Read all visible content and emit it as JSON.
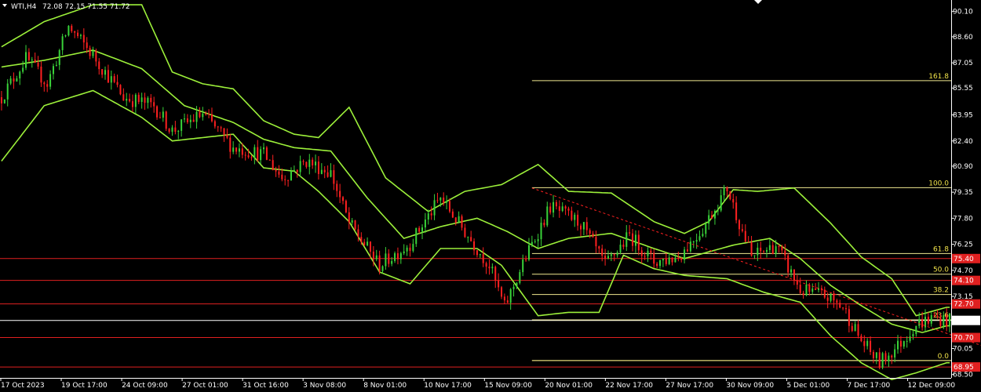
{
  "header": {
    "symbol": "WTI,H4",
    "ohlc": "72.08 72.15 71.55 71.72"
  },
  "colors": {
    "background": "#000000",
    "bull": "#39d339",
    "bear": "#ff2020",
    "bands": "#9cf03a",
    "fib": "#f0e890",
    "hline_red": "#e02020",
    "hline_yellow": "#f0d020",
    "price_tag_white": "#ffffff",
    "price_tag_red": "#e02020"
  },
  "chart_data": {
    "type": "candlestick",
    "symbol": "WTI",
    "timeframe": "H4",
    "ylim": [
      68.3,
      90.6
    ],
    "y_ticks": [
      "90.10",
      "88.60",
      "87.05",
      "85.55",
      "83.95",
      "82.40",
      "80.90",
      "79.35",
      "77.80",
      "76.25",
      "74.70",
      "73.15",
      "70.05",
      "68.50"
    ],
    "x_ticks": [
      "17 Oct 2023",
      "19 Oct 17:00",
      "24 Oct 09:00",
      "27 Oct 01:00",
      "31 Oct 16:00",
      "3 Nov 08:00",
      "8 Nov 01:00",
      "10 Nov 17:00",
      "15 Nov 09:00",
      "20 Nov 01:00",
      "22 Nov 17:00",
      "27 Nov 17:00",
      "30 Nov 09:00",
      "5 Dec 01:00",
      "7 Dec 17:00",
      "12 Dec 09:00"
    ],
    "close_path": [
      {
        "t": 0,
        "p": 85.0
      },
      {
        "t": 8,
        "p": 87.3
      },
      {
        "t": 15,
        "p": 85.8
      },
      {
        "t": 22,
        "p": 89.2
      },
      {
        "t": 30,
        "p": 87.5
      },
      {
        "t": 40,
        "p": 85.0
      },
      {
        "t": 50,
        "p": 84.5
      },
      {
        "t": 56,
        "p": 83.0
      },
      {
        "t": 66,
        "p": 84.0
      },
      {
        "t": 76,
        "p": 82.0
      },
      {
        "t": 86,
        "p": 81.6
      },
      {
        "t": 92,
        "p": 80.2
      },
      {
        "t": 100,
        "p": 81.2
      },
      {
        "t": 108,
        "p": 80.5
      },
      {
        "t": 114,
        "p": 77.5
      },
      {
        "t": 124,
        "p": 75.0
      },
      {
        "t": 134,
        "p": 76.3
      },
      {
        "t": 144,
        "p": 79.0
      },
      {
        "t": 152,
        "p": 77.0
      },
      {
        "t": 160,
        "p": 75.0
      },
      {
        "t": 165,
        "p": 72.5
      },
      {
        "t": 172,
        "p": 75.5
      },
      {
        "t": 180,
        "p": 78.5
      },
      {
        "t": 190,
        "p": 77.5
      },
      {
        "t": 198,
        "p": 75.0
      },
      {
        "t": 206,
        "p": 76.8
      },
      {
        "t": 214,
        "p": 75.2
      },
      {
        "t": 222,
        "p": 75.5
      },
      {
        "t": 230,
        "p": 77.2
      },
      {
        "t": 238,
        "p": 79.6
      },
      {
        "t": 246,
        "p": 75.5
      },
      {
        "t": 254,
        "p": 76.2
      },
      {
        "t": 262,
        "p": 73.5
      },
      {
        "t": 270,
        "p": 73.2
      },
      {
        "t": 276,
        "p": 72.5
      },
      {
        "t": 282,
        "p": 70.5
      },
      {
        "t": 288,
        "p": 69.2
      },
      {
        "t": 294,
        "p": 70.2
      },
      {
        "t": 300,
        "p": 71.5
      },
      {
        "t": 306,
        "p": 71.9
      },
      {
        "t": 310,
        "p": 71.72
      }
    ],
    "total_bars": 312,
    "upper_band": [
      {
        "t": 0,
        "p": 88.0
      },
      {
        "t": 14,
        "p": 89.5
      },
      {
        "t": 30,
        "p": 90.5
      },
      {
        "t": 46,
        "p": 90.5
      },
      {
        "t": 56,
        "p": 86.5
      },
      {
        "t": 66,
        "p": 85.8
      },
      {
        "t": 76,
        "p": 85.5
      },
      {
        "t": 86,
        "p": 83.6
      },
      {
        "t": 96,
        "p": 82.8
      },
      {
        "t": 104,
        "p": 82.6
      },
      {
        "t": 114,
        "p": 84.4
      },
      {
        "t": 126,
        "p": 80.2
      },
      {
        "t": 140,
        "p": 78.2
      },
      {
        "t": 152,
        "p": 79.4
      },
      {
        "t": 164,
        "p": 79.8
      },
      {
        "t": 176,
        "p": 81.0
      },
      {
        "t": 186,
        "p": 79.4
      },
      {
        "t": 200,
        "p": 79.3
      },
      {
        "t": 214,
        "p": 77.6
      },
      {
        "t": 224,
        "p": 76.9
      },
      {
        "t": 232,
        "p": 77.6
      },
      {
        "t": 240,
        "p": 79.5
      },
      {
        "t": 248,
        "p": 79.4
      },
      {
        "t": 260,
        "p": 79.6
      },
      {
        "t": 272,
        "p": 77.5
      },
      {
        "t": 282,
        "p": 75.5
      },
      {
        "t": 292,
        "p": 74.2
      },
      {
        "t": 300,
        "p": 72.0
      },
      {
        "t": 310,
        "p": 72.5
      }
    ],
    "middle_band": [
      {
        "t": 0,
        "p": 86.8
      },
      {
        "t": 14,
        "p": 87.2
      },
      {
        "t": 30,
        "p": 87.8
      },
      {
        "t": 46,
        "p": 86.7
      },
      {
        "t": 60,
        "p": 84.5
      },
      {
        "t": 76,
        "p": 83.5
      },
      {
        "t": 86,
        "p": 82.5
      },
      {
        "t": 96,
        "p": 82.0
      },
      {
        "t": 108,
        "p": 81.8
      },
      {
        "t": 120,
        "p": 79.0
      },
      {
        "t": 132,
        "p": 76.6
      },
      {
        "t": 144,
        "p": 77.3
      },
      {
        "t": 156,
        "p": 77.8
      },
      {
        "t": 166,
        "p": 77.0
      },
      {
        "t": 176,
        "p": 76.0
      },
      {
        "t": 186,
        "p": 76.6
      },
      {
        "t": 200,
        "p": 76.9
      },
      {
        "t": 214,
        "p": 76.0
      },
      {
        "t": 224,
        "p": 75.4
      },
      {
        "t": 240,
        "p": 76.2
      },
      {
        "t": 252,
        "p": 76.6
      },
      {
        "t": 262,
        "p": 75.4
      },
      {
        "t": 272,
        "p": 73.8
      },
      {
        "t": 282,
        "p": 72.6
      },
      {
        "t": 292,
        "p": 71.5
      },
      {
        "t": 302,
        "p": 71.0
      },
      {
        "t": 310,
        "p": 71.4
      }
    ],
    "lower_band": [
      {
        "t": 0,
        "p": 81.2
      },
      {
        "t": 14,
        "p": 84.5
      },
      {
        "t": 30,
        "p": 85.4
      },
      {
        "t": 46,
        "p": 83.8
      },
      {
        "t": 56,
        "p": 82.4
      },
      {
        "t": 66,
        "p": 82.6
      },
      {
        "t": 76,
        "p": 82.8
      },
      {
        "t": 86,
        "p": 80.8
      },
      {
        "t": 96,
        "p": 80.6
      },
      {
        "t": 104,
        "p": 79.4
      },
      {
        "t": 114,
        "p": 77.6
      },
      {
        "t": 124,
        "p": 74.6
      },
      {
        "t": 134,
        "p": 73.9
      },
      {
        "t": 144,
        "p": 76.0
      },
      {
        "t": 156,
        "p": 76.0
      },
      {
        "t": 164,
        "p": 75.0
      },
      {
        "t": 176,
        "p": 72.0
      },
      {
        "t": 186,
        "p": 72.2
      },
      {
        "t": 196,
        "p": 72.2
      },
      {
        "t": 204,
        "p": 75.6
      },
      {
        "t": 214,
        "p": 74.8
      },
      {
        "t": 224,
        "p": 74.4
      },
      {
        "t": 238,
        "p": 74.2
      },
      {
        "t": 250,
        "p": 73.4
      },
      {
        "t": 262,
        "p": 72.8
      },
      {
        "t": 272,
        "p": 70.8
      },
      {
        "t": 282,
        "p": 69.2
      },
      {
        "t": 292,
        "p": 68.2
      },
      {
        "t": 300,
        "p": 68.6
      },
      {
        "t": 310,
        "p": 69.2
      }
    ],
    "fib_levels": [
      {
        "label": "161.8",
        "price": 85.99
      },
      {
        "label": "100.0",
        "price": 79.62
      },
      {
        "label": "61.8",
        "price": 75.7
      },
      {
        "label": "50.0",
        "price": 74.47
      },
      {
        "label": "38.2",
        "price": 73.26
      },
      {
        "label": "23.6",
        "price": 71.75
      },
      {
        "label": "0.0",
        "price": 69.33
      }
    ],
    "fib_start_t": 174,
    "horizontal_lines": [
      {
        "price": 75.4,
        "label": "75.40",
        "color": "red"
      },
      {
        "price": 74.1,
        "label": "74.10",
        "color": "red"
      },
      {
        "price": 72.7,
        "label": "72.70",
        "color": "red"
      },
      {
        "price": 71.72,
        "label": "71.72",
        "color": "white"
      },
      {
        "price": 70.7,
        "label": "70.70",
        "color": "red"
      },
      {
        "price": 68.95,
        "label": "68.95",
        "color": "red"
      },
      {
        "price": 69.33,
        "label": "",
        "color": "yellow"
      }
    ],
    "trendline": {
      "t1": 174,
      "p1": 79.6,
      "t2": 336,
      "p2": 69.3
    }
  }
}
